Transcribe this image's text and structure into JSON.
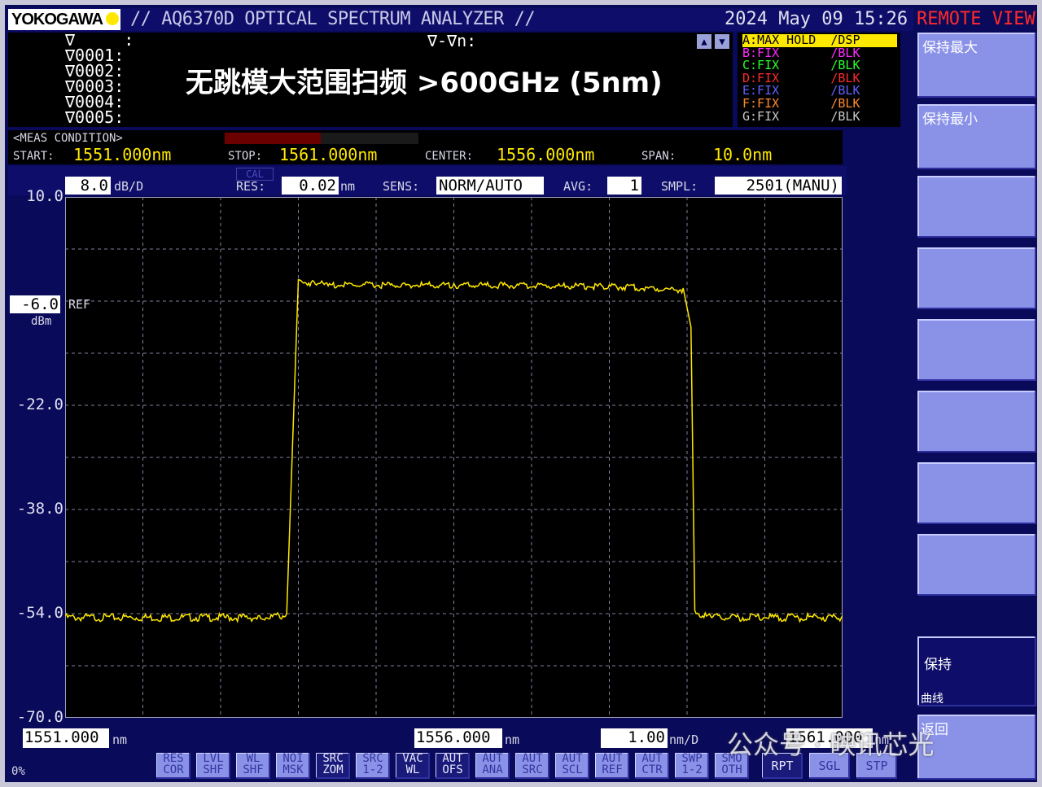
{
  "header": {
    "brand": "YOKOGAWA",
    "title": "// AQ6370D OPTICAL SPECTRUM ANALYZER //",
    "datetime": "2024 May 09 15:26",
    "remote": "REMOTE VIEW"
  },
  "markers": {
    "lines": "∇     :\n∇0001:\n∇0002:\n∇0003:\n∇0004:\n∇0005:",
    "delta": "∇-∇n:"
  },
  "overlay_caption": "无跳模大范围扫频 >600GHz (5nm)",
  "traces": [
    {
      "label": "A:MAX HOLD  /DSP",
      "color": "#000000",
      "bg": "#ffe800"
    },
    {
      "label": "B:FIX       /BLK",
      "color": "#ff2aff"
    },
    {
      "label": "C:FIX       /BLK",
      "color": "#2aff2a"
    },
    {
      "label": "D:FIX       /BLK",
      "color": "#ff2a2a"
    },
    {
      "label": "E:FIX       /BLK",
      "color": "#6060ff"
    },
    {
      "label": "F:FIX       /BLK",
      "color": "#ff8a2a"
    },
    {
      "label": "G:FIX       /BLK",
      "color": "#c8c8c8"
    }
  ],
  "meas": {
    "title": "<MEAS CONDITION>",
    "start_label": "START:",
    "start_val": "1551.000nm",
    "stop_label": "STOP:",
    "stop_val": "1561.000nm",
    "center_label": "CENTER:",
    "center_val": "1556.000nm",
    "span_label": "SPAN:",
    "span_val": "10.0nm"
  },
  "params": {
    "dbd_val": "8.0",
    "dbd_unit": "dB/D",
    "cal": "CAL",
    "res_label": "RES:",
    "res_val": "0.02",
    "res_unit": "nm",
    "sens_label": "SENS:",
    "sens_val": "NORM/AUTO",
    "avg_label": "AVG:",
    "avg_val": "1",
    "smpl_label": "SMPL:",
    "smpl_val": "2501(MANU)"
  },
  "axis": {
    "ref_val": "-6.0",
    "ref_label": "REF",
    "ref_unit": "dBm",
    "x_start": "1551.000",
    "x_center": "1556.000",
    "x_stop": "1561.000",
    "x_unit": "nm",
    "x_div": "1.00",
    "x_div_unit": "nm/D",
    "progress": "0%"
  },
  "chart_data": {
    "type": "line",
    "xlabel": "",
    "ylabel": "",
    "xlim": [
      1551.0,
      1561.0
    ],
    "ylim": [
      -70.0,
      10.0
    ],
    "y_ticks": [
      "10.0",
      "-6.0",
      "-22.0",
      "-38.0",
      "-54.0",
      "-70.0"
    ],
    "grid": true,
    "series": [
      {
        "color": "#ffe800",
        "x": [
          1551.0,
          1553.5,
          1553.85,
          1554.0,
          1554.2,
          1554.4,
          1556.0,
          1558.0,
          1558.95,
          1559.05,
          1559.1,
          1559.3,
          1561.0
        ],
        "y": [
          -54.3,
          -54.3,
          -54.0,
          -2.7,
          -3.0,
          -3.3,
          -3.3,
          -3.5,
          -4.0,
          -10.0,
          -53.5,
          -54.3,
          -54.3
        ]
      }
    ]
  },
  "softkeys": [
    "保持最大",
    "保持最小",
    "",
    "",
    "",
    "",
    "",
    "",
    "保持",
    "曲线",
    "返回"
  ],
  "function_keys": [
    {
      "label": "RES\nCOR",
      "active": false
    },
    {
      "label": "LVL\nSHF",
      "active": false
    },
    {
      "label": "WL\nSHF",
      "active": false
    },
    {
      "label": "NOI\nMSK",
      "active": false
    },
    {
      "label": "SRC\nZOM",
      "active": true
    },
    {
      "label": "SRC\n1-2",
      "active": false
    },
    {
      "label": "VAC\nWL",
      "active": true
    },
    {
      "label": "AUT\nOFS",
      "active": true
    },
    {
      "label": "AUT\nANA",
      "active": false
    },
    {
      "label": "AUT\nSRC",
      "active": false
    },
    {
      "label": "AUT\nSCL",
      "active": false
    },
    {
      "label": "AUT\nREF",
      "active": false
    },
    {
      "label": "AUT\nCTR",
      "active": false
    },
    {
      "label": "SWP\n1-2",
      "active": false
    },
    {
      "label": "SMO\nOTH",
      "active": false
    }
  ],
  "sweep_buttons": [
    "RPT",
    "SGL",
    "STP"
  ],
  "watermark": "公众号 · 映讯芯光"
}
